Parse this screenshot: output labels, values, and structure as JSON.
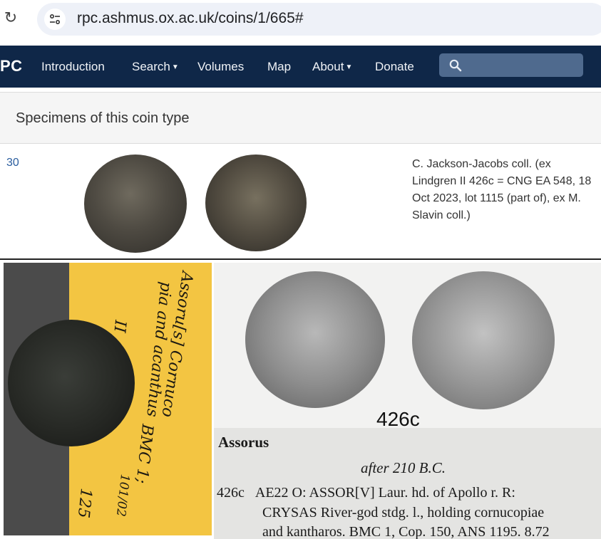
{
  "browser": {
    "reload_icon": "reload-icon",
    "url": "rpc.ashmus.ox.ac.uk/coins/1/665#"
  },
  "nav": {
    "brand": "PC",
    "items": [
      {
        "label": "Introduction"
      },
      {
        "label": "Search",
        "dropdown": true
      },
      {
        "label": "Volumes"
      },
      {
        "label": "Map"
      },
      {
        "label": "About",
        "dropdown": true
      },
      {
        "label": "Donate"
      }
    ],
    "search_placeholder": ""
  },
  "panel": {
    "title": "Specimens of this coin type"
  },
  "specimen": {
    "number": "30",
    "provenance": "C. Jackson-Jacobs coll. (ex Lindgren II 426c = CNG EA 548, 18 Oct 2023, lot 1115 (part of), ex M. Slavin coll.)"
  },
  "label_photo": {
    "handwriting": [
      "Assoru[s] Cornuco",
      "pia and acanthus",
      "II",
      "BMC 1;",
      "101/02",
      "125"
    ]
  },
  "catalogue_plate": {
    "plate_number": "426c",
    "title": "Assorus",
    "date": "after 210 B.C.",
    "entry_number": "426c",
    "line1": "AE22  O: ASSOR[V] Laur. hd. of Apollo r. R:",
    "line2": "CRYSAS River-god stdg. l., holding cornucopiae",
    "line3": "and kantharos. BMC 1, Cop. 150, ANS 1195. 8.72"
  },
  "colors": {
    "navbar": "#0f2748",
    "link": "#2a5d9e",
    "label_card": "#f3c542"
  }
}
